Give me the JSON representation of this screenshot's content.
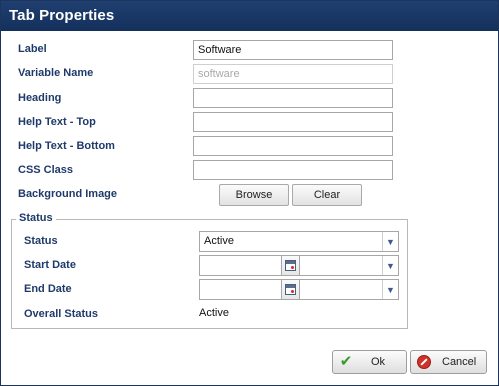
{
  "dialog": {
    "title": "Tab Properties"
  },
  "form": {
    "label": {
      "caption": "Label",
      "value": "Software"
    },
    "variable_name": {
      "caption": "Variable Name",
      "value": "software"
    },
    "heading": {
      "caption": "Heading",
      "value": ""
    },
    "help_top": {
      "caption": "Help Text - Top",
      "value": ""
    },
    "help_bottom": {
      "caption": "Help Text - Bottom",
      "value": ""
    },
    "css_class": {
      "caption": "CSS Class",
      "value": ""
    },
    "background_image": {
      "caption": "Background Image",
      "browse_label": "Browse",
      "clear_label": "Clear"
    }
  },
  "status_group": {
    "legend": "Status",
    "status": {
      "caption": "Status",
      "selected": "Active"
    },
    "start_date": {
      "caption": "Start Date",
      "date": "",
      "time": ""
    },
    "end_date": {
      "caption": "End Date",
      "date": "",
      "time": ""
    },
    "overall_status": {
      "caption": "Overall Status",
      "value": "Active"
    }
  },
  "footer": {
    "ok_label": "Ok",
    "cancel_label": "Cancel"
  },
  "icons": {
    "ok": "check-icon",
    "cancel": "cancel-icon",
    "calendar": "calendar-icon",
    "dropdown": "chevron-down-icon"
  },
  "colors": {
    "title_bar": "#1a3766",
    "label_text": "#1f3a6a"
  }
}
